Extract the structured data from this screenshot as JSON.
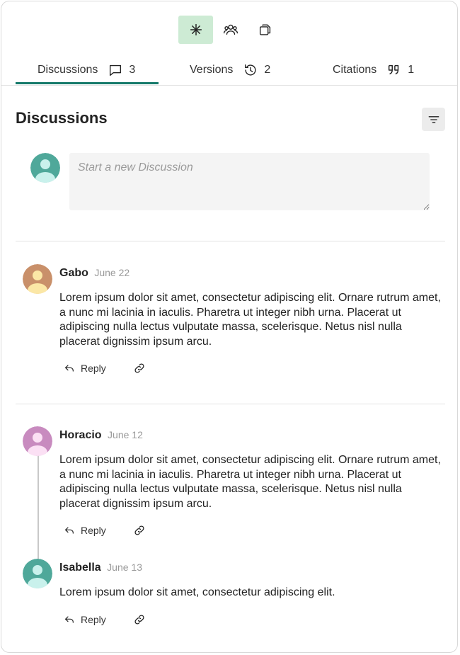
{
  "toolbar": {
    "buttons": [
      {
        "icon": "asterisk-icon",
        "active": true
      },
      {
        "icon": "users-icon",
        "active": false
      },
      {
        "icon": "copy-icon",
        "active": false
      }
    ]
  },
  "tabs": [
    {
      "label": "Discussions",
      "count": "3",
      "icon": "comment-icon",
      "active": true
    },
    {
      "label": "Versions",
      "count": "2",
      "icon": "history-icon",
      "active": false
    },
    {
      "label": "Citations",
      "count": "1",
      "icon": "quote-icon",
      "active": false
    }
  ],
  "heading": "Discussions",
  "composer": {
    "placeholder": "Start a new Discussion"
  },
  "comments": [
    {
      "author": "Gabo",
      "date": "June 22",
      "body": "Lorem ipsum dolor sit amet, consectetur adipiscing elit. Ornare rutrum amet, a nunc mi lacinia in iaculis. Pharetra ut integer nibh urna. Placerat ut adipiscing nulla lectus vulputate massa, scelerisque. Netus nisl nulla placerat dignissim ipsum arcu.",
      "reply_label": "Reply",
      "avatar_color": "#c9906a"
    },
    {
      "author": "Horacio",
      "date": "June 12",
      "body": "Lorem ipsum dolor sit amet, consectetur adipiscing elit. Ornare rutrum amet, a nunc mi lacinia in iaculis. Pharetra ut integer nibh urna. Placerat ut adipiscing nulla lectus vulputate massa, scelerisque. Netus nisl nulla placerat dignissim ipsum arcu.",
      "reply_label": "Reply",
      "avatar_color": "#c88bbf"
    },
    {
      "author": "Isabella",
      "date": "June 13",
      "body": "Lorem ipsum dolor sit amet, consectetur adipiscing elit.",
      "reply_label": "Reply",
      "avatar_color": "#4fa89a"
    }
  ],
  "colors": {
    "accent": "#167a6b",
    "active_toolbar": "#cdebd4",
    "composer_avatar": "#4fa89a"
  }
}
